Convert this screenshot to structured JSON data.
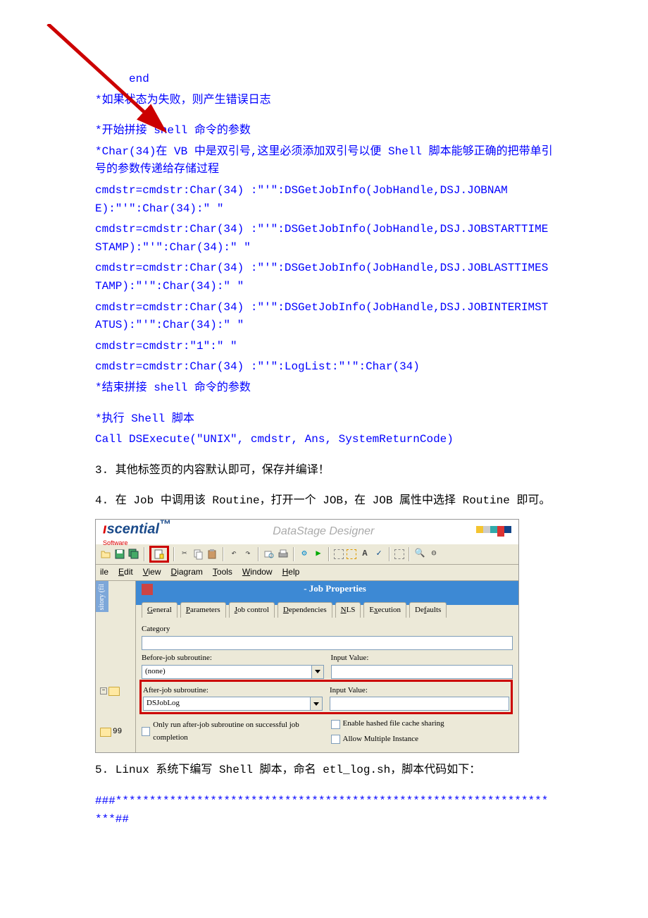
{
  "code_end": "end",
  "c_fail": "*如果状态为失败，则产生错误日志",
  "c_begin": "*开始拼接 shell 命令的参数",
  "c_char34": "*Char(34)在 VB 中是双引号,这里必须添加双引号以便 Shell 脚本能够正确的把带单引号的参数传递给存储过程",
  "l1": "cmdstr=cmdstr:Char(34) :\"'\":DSGetJobInfo(JobHandle,DSJ.JOBNAME):\"'\":Char(34):\" \"",
  "l2": "cmdstr=cmdstr:Char(34) :\"'\":DSGetJobInfo(JobHandle,DSJ.JOBSTARTTIMESTAMP):\"'\":Char(34):\" \"",
  "l3": "cmdstr=cmdstr:Char(34) :\"'\":DSGetJobInfo(JobHandle,DSJ.JOBLASTTIMESTAMP):\"'\":Char(34):\" \"",
  "l4": "cmdstr=cmdstr:Char(34) :\"'\":DSGetJobInfo(JobHandle,DSJ.JOBINTERIMSTATUS):\"'\":Char(34):\" \"",
  "l5": "cmdstr=cmdstr:\"1\":\" \"",
  "l6": "cmdstr=cmdstr:Char(34) :\"'\":LogList:\"'\":Char(34)",
  "c_end": "*结束拼接 shell 命令的参数",
  "c_exec": "*执行 Shell 脚本",
  "l7": "Call DSExecute(\"UNIX\", cmdstr, Ans, SystemReturnCode)",
  "step3": "3. 其他标签页的内容默认即可，保存并编译！",
  "step4": "4. 在 Job 中调用该 Routine，打开一个 JOB，在 JOB 属性中选择 Routine 即可。",
  "step5": "5. Linux 系统下编写 Shell 脚本，命名 etl_log.sh，脚本代码如下：",
  "hashline": "###*******************************************************************##",
  "ds": {
    "logo": "scential",
    "logo_dot": "ı",
    "logo_sw": "Software",
    "title": "DataStage Designer",
    "menu": {
      "file": "ile",
      "edit": "Edit",
      "view": "View",
      "diagram": "Diagram",
      "tools": "Tools",
      "window": "Window",
      "help": "Help"
    },
    "sidebar_tab": "sitory (fil",
    "sidebar_num": "99",
    "pane_title": "- Job Properties",
    "tabs": [
      "General",
      "Parameters",
      "Job control",
      "Dependencies",
      "NLS",
      "Execution",
      "Defaults"
    ],
    "labels": {
      "category": "Category",
      "before": "Before-job subroutine:",
      "before_val": "(none)",
      "after": "After-job subroutine:",
      "after_val": "DSJobLog",
      "input1": "Input Value:",
      "input2": "Input Value:",
      "only_run": "Only run after-job subroutine on successful job completion",
      "enable_hash": "Enable hashed file cache sharing",
      "allow_multi": "Allow Multiple Instance"
    }
  }
}
